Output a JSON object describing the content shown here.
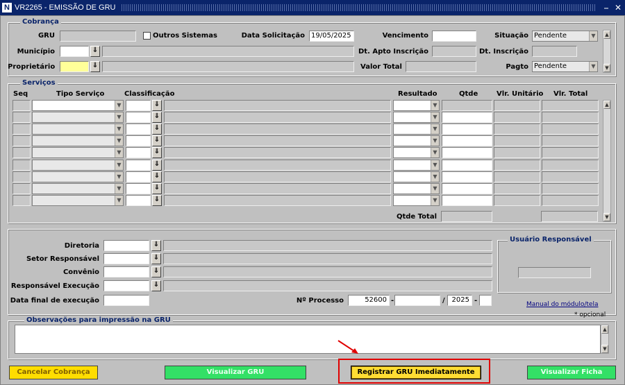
{
  "window": {
    "icon_letter": "N",
    "title": "VR2265 - EMISSÃO DE GRU",
    "min_glyph": "⎯",
    "close_glyph": "✕"
  },
  "cobranca": {
    "title": "Cobrança",
    "gru_label": "GRU",
    "gru_value": "",
    "outros_sistemas_label": "Outros Sistemas",
    "data_solicitacao_label": "Data Solicitação",
    "data_solicitacao_value": "19/05/2025",
    "vencimento_label": "Vencimento",
    "situacao_label": "Situação",
    "situacao_value": "Pendente",
    "municipio_label": "Município",
    "dt_apto_label": "Dt. Apto Inscrição",
    "dt_inscricao_label": "Dt. Inscrição",
    "proprietario_label": "Proprietário",
    "valor_total_label": "Valor Total",
    "pagto_label": "Pagto",
    "pagto_value": "Pendente"
  },
  "servicos": {
    "title": "Serviços",
    "columns": {
      "seq": "Seq",
      "tipo_servico": "Tipo Serviço",
      "classificacao": "Classificação",
      "resultado": "Resultado",
      "qtde": "Qtde",
      "vlr_unitario": "Vlr. Unitário",
      "vlr_total": "Vlr. Total"
    },
    "qtde_total_label": "Qtde Total"
  },
  "responsavel": {
    "diretoria_label": "Diretoria",
    "setor_label": "Setor Responsável",
    "convenio_label": "Convênio",
    "resp_execucao_label": "Responsável Execução",
    "data_final_label": "Data final de execução",
    "processo_label": "Nº Processo",
    "processo_parte1": "52600",
    "processo_parte2": "",
    "processo_ano": "2025",
    "processo_digito": "",
    "usuario_title": "Usuário Responsável",
    "manual_link": "Manual do módulo/tela"
  },
  "observacoes": {
    "title": "Observações para impressão na GRU",
    "opcional": "* opcional"
  },
  "buttons": {
    "cancelar": "Cancelar Cobrança",
    "visualizar_gru": "Visualizar GRU",
    "registrar": "Registrar GRU Imediatamente",
    "visualizar_ficha": "Visualizar Ficha"
  },
  "colors": {
    "highlight": "#e00000",
    "primary_button": "#ffdd33",
    "green_button": "#33e066",
    "title_bar": "#0a246a"
  }
}
